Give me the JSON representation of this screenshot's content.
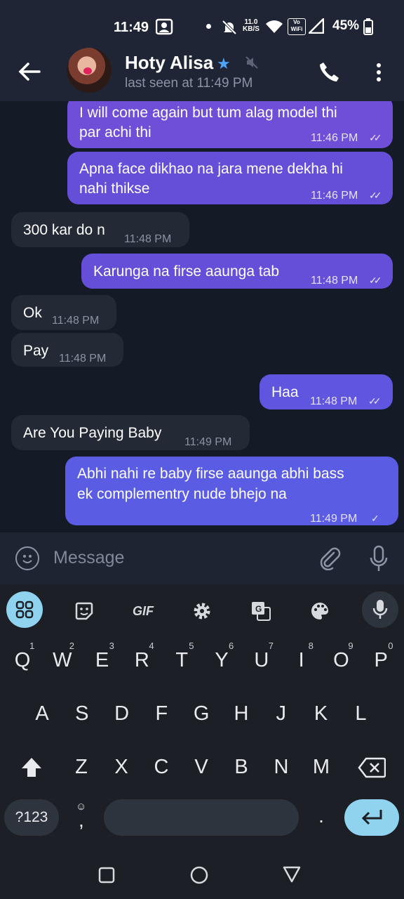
{
  "status": {
    "time": "11:49",
    "speed_value": "11.0",
    "speed_unit": "KB/S",
    "volte": "Vo",
    "wifi": "WiFi",
    "battery": "45%"
  },
  "header": {
    "name": "Hoty Alisa",
    "last_seen": "last seen at 11:49 PM"
  },
  "messages": [
    {
      "dir": "out",
      "lines": [
        "I will come again but tum alag model thi",
        "par achi thi"
      ],
      "time": "11:46 PM",
      "ticks": "✓✓"
    },
    {
      "dir": "out",
      "lines": [
        "Apna face dikhao na jara mene dekha hi",
        "nahi thikse"
      ],
      "time": "11:46 PM",
      "ticks": "✓✓"
    },
    {
      "dir": "in",
      "lines": [
        "300 kar do n"
      ],
      "time": "11:48 PM"
    },
    {
      "dir": "out",
      "lines": [
        "Karunga na firse aaunga tab"
      ],
      "time": "11:48 PM",
      "ticks": "✓✓"
    },
    {
      "dir": "in",
      "lines": [
        "Ok"
      ],
      "time": "11:48 PM"
    },
    {
      "dir": "in",
      "lines": [
        "Pay"
      ],
      "time": "11:48 PM"
    },
    {
      "dir": "out",
      "lines": [
        "Haa"
      ],
      "time": "11:48 PM",
      "ticks": "✓✓"
    },
    {
      "dir": "in",
      "lines": [
        "Are You Paying Baby"
      ],
      "time": "11:49 PM"
    },
    {
      "dir": "out",
      "lines": [
        "Abhi nahi re baby firse aaunga abhi bass",
        "ek complementry nude bhejo na"
      ],
      "time": "11:49 PM",
      "ticks": "✓"
    }
  ],
  "input": {
    "placeholder": "Message"
  },
  "keyboard": {
    "toolbar": {
      "gif": "GIF"
    },
    "row1": [
      "Q",
      "W",
      "E",
      "R",
      "T",
      "Y",
      "U",
      "I",
      "O",
      "P"
    ],
    "row1_hints": [
      "1",
      "2",
      "3",
      "4",
      "5",
      "6",
      "7",
      "8",
      "9",
      "0"
    ],
    "row2": [
      "A",
      "S",
      "D",
      "F",
      "G",
      "H",
      "J",
      "K",
      "L"
    ],
    "row3": [
      "Z",
      "X",
      "C",
      "V",
      "B",
      "N",
      "M"
    ],
    "symbols": "?123",
    "emoji_comma": ",",
    "period": "."
  },
  "colors": {
    "outgoing_bubble": "#6f4ed8",
    "incoming_bubble": "#232a36",
    "enter_key": "#8fd3ef",
    "accent_star": "#4ea4f6"
  }
}
